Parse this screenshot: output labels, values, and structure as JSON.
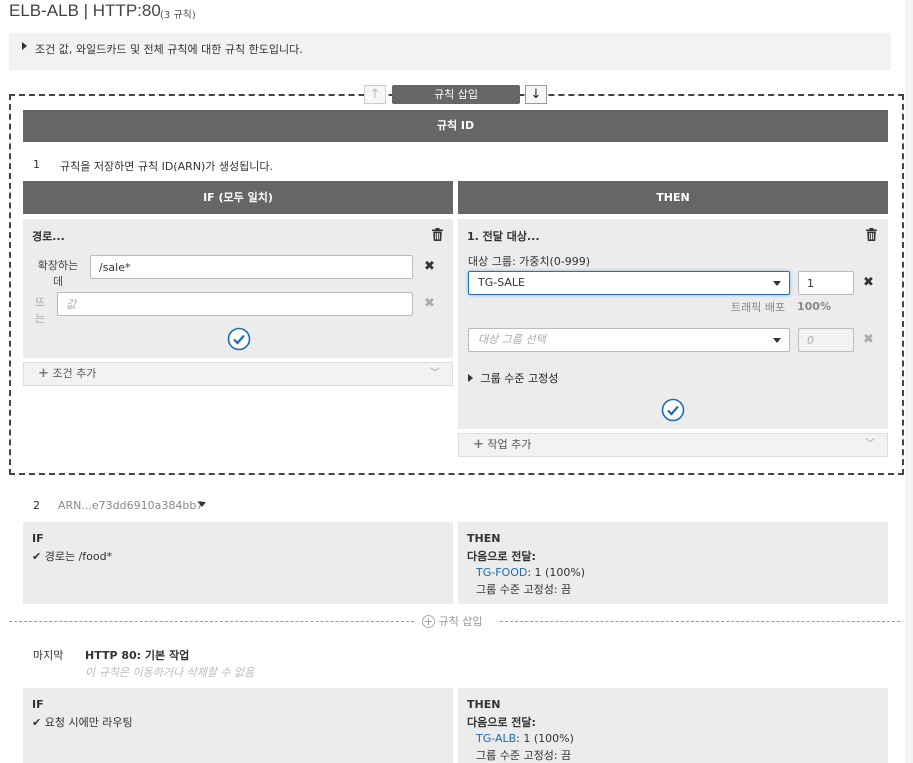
{
  "header": {
    "title": "ELB-ALB | HTTP:80",
    "rule_count": "(3 규칙)"
  },
  "info": {
    "text": "조건 값, 와일드카드 및 전체 규칙에 대한 규칙 한도입니다."
  },
  "toolbar": {
    "up": "↑",
    "insert_label": "규칙 삽입",
    "down": "↓"
  },
  "edit_rule": {
    "id_header": "규칙 ID",
    "number": "1",
    "id_note": "규칙을 저장하면 규칙 ID(ARN)가 생성됩니다.",
    "if_header": "IF (모두 일치)",
    "then_header": "THEN",
    "condition": {
      "title": "경로...",
      "label_extends": "확장하는 데",
      "value_1": "/sale*",
      "label_or": "또는",
      "placeholder_2": "값"
    },
    "add_condition": "조건 추가",
    "action": {
      "title": "1. 전달 대상...",
      "target_group_label": "대상 그룹: 가중치(0-999)",
      "selected_group": "TG-SALE",
      "weight_1": "1",
      "traffic_label": "트래픽 배포",
      "traffic_value": "100%",
      "select_placeholder": "대상 그룹 선택",
      "weight_2_placeholder": "0",
      "stickiness": "그룹 수준 고정성"
    },
    "add_action": "작업 추가"
  },
  "rule2": {
    "number": "2",
    "arn": "ARN...e73dd6910a384bb7",
    "if_label": "IF",
    "if_condition": "경로는 /food*",
    "then_label": "THEN",
    "forward_label": "다음으로 전달:",
    "target": "TG-FOOD",
    "target_detail": ": 1 (100%)",
    "stickiness": "그룹 수준 고정성: 끔"
  },
  "insert_rule_label": "규칙 삽입",
  "last_rule": {
    "label": "마지막",
    "title": "HTTP 80: 기본 작업",
    "note": "이 규칙은 이동하거나 삭제할 수 없음",
    "if_label": "IF",
    "if_condition": "요청 시에만 라우팅",
    "then_label": "THEN",
    "forward_label": "다음으로 전달:",
    "target": "TG-ALB",
    "target_detail": ": 1 (100%)",
    "stickiness": "그룹 수준 고정성: 끔"
  },
  "colors": {
    "bar": "#666666",
    "link": "#1a6bb5",
    "accent": "#1b6bb5"
  }
}
